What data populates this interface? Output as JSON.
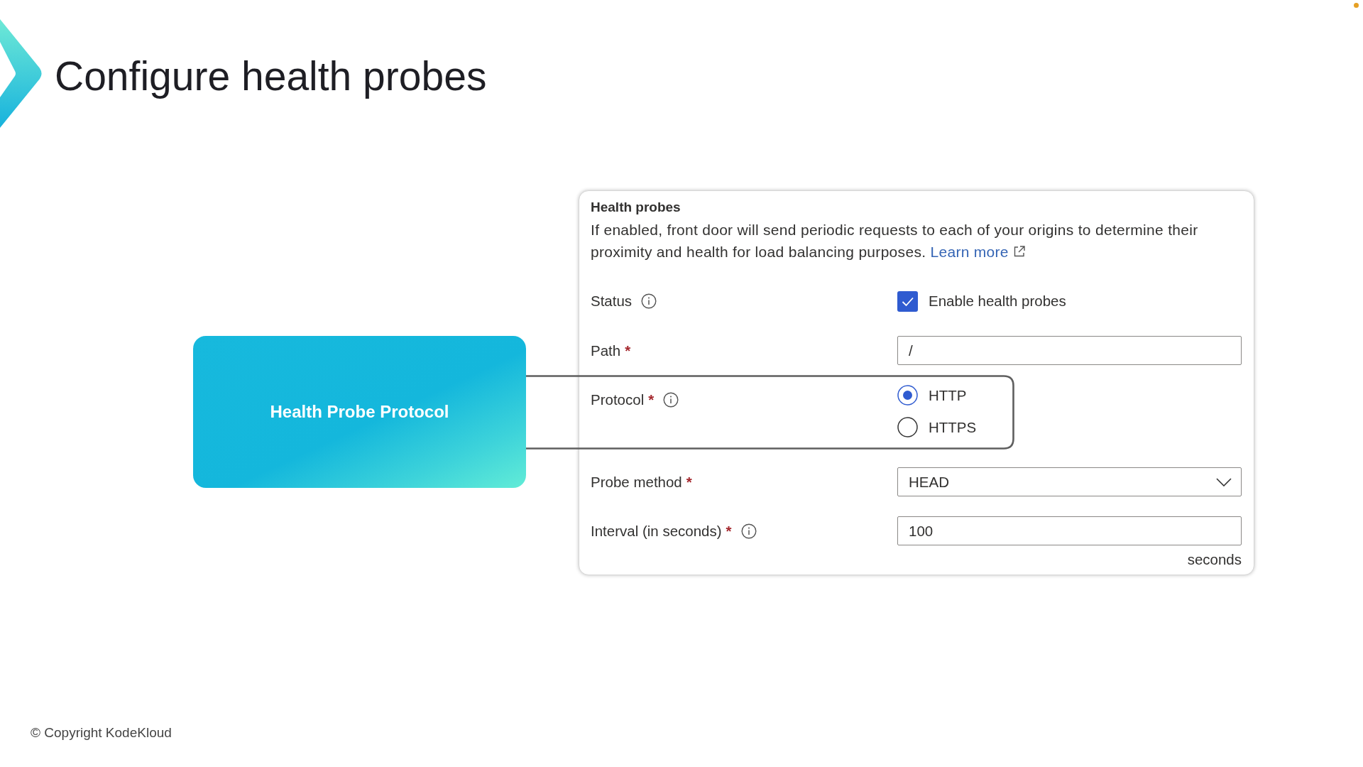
{
  "slide": {
    "title": "Configure health probes",
    "footer": "© Copyright KodeKloud"
  },
  "callout": {
    "label": "Health Probe Protocol"
  },
  "panel": {
    "title": "Health probes",
    "description": "If enabled, front door will send periodic requests to each of your origins to determine their proximity and health for load balancing purposes.",
    "link": "Learn more",
    "fields": [
      {
        "kind": "checkbox",
        "label": "Status",
        "info": true,
        "option": "Enable health probes",
        "checked": true
      },
      {
        "kind": "text",
        "label": "Path",
        "required_mark": "*",
        "info": false,
        "value": "/"
      },
      {
        "kind": "radio",
        "label": "Protocol",
        "required_mark": "*",
        "info": true,
        "options": [
          {
            "label": "HTTP",
            "selected": true
          },
          {
            "label": "HTTPS",
            "selected": false
          }
        ]
      },
      {
        "kind": "select",
        "label": "Probe method",
        "required_mark": "*",
        "info": false,
        "value": "HEAD"
      },
      {
        "kind": "text",
        "label": "Interval (in seconds)",
        "required_mark": "*",
        "info": true,
        "value": "100",
        "suffix": "seconds"
      }
    ]
  }
}
